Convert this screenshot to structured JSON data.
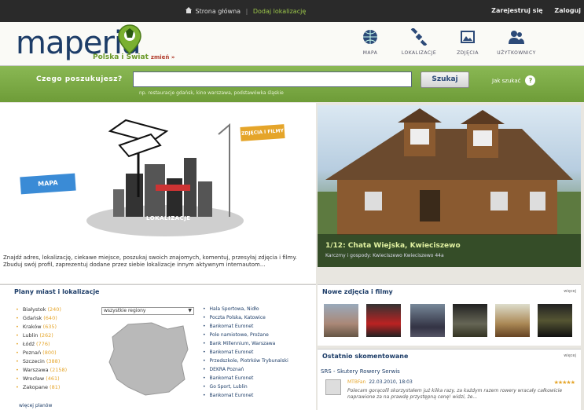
{
  "topbar": {
    "home": "Strona główna",
    "add_location": "Dodaj lokalizację",
    "register": "Zarejestruj się",
    "login": "Zaloguj"
  },
  "header": {
    "logo": "maperia",
    "tagline": "Polska i Świat",
    "change": "zmień »",
    "nav": [
      {
        "label": "MAPA",
        "icon": "globe-icon"
      },
      {
        "label": "LOKALIZACJE",
        "icon": "satellite-icon"
      },
      {
        "label": "ZDJĘCIA",
        "icon": "photo-icon"
      },
      {
        "label": "UŻYTKOWNICY",
        "icon": "users-icon"
      }
    ]
  },
  "search": {
    "question": "Czego poszukujesz?",
    "placeholder": "",
    "hint": "np. restauracje gdańsk, kino warszawa, podstawówka śląskie",
    "button": "Szukaj",
    "how": "Jak szukać"
  },
  "hero": {
    "mapa": "MAPA",
    "zdjecia": "ZDJĘCIA I FILMY",
    "lokalizacje": "LOKALIZACJE",
    "description": "Znajdź adres, lokalizację, ciekawe miejsce, poszukaj swoich znajomych, komentuj, przesyłaj zdjęcia i filmy. Zbuduj swój profil, zaprezentuj dodane przez siebie lokalizacje innym aktywnym internautom..."
  },
  "featured": {
    "title": "1/12: Chata Wiejska, Kwieciszewo",
    "subtitle": "Karczmy i gospody: Kwieciszewo Kwieciszewo 44a"
  },
  "plany": {
    "title": "Plany miast i lokalizacje",
    "cities": [
      {
        "name": "Białystok",
        "count": "(240)"
      },
      {
        "name": "Gdańsk",
        "count": "(640)"
      },
      {
        "name": "Kraków",
        "count": "(635)"
      },
      {
        "name": "Lublin",
        "count": "(262)"
      },
      {
        "name": "Łódź",
        "count": "(776)"
      },
      {
        "name": "Poznań",
        "count": "(800)"
      },
      {
        "name": "Szczecin",
        "count": "(388)"
      },
      {
        "name": "Warszawa",
        "count": "(2158)"
      },
      {
        "name": "Wrocław",
        "count": "(461)"
      },
      {
        "name": "Zakopane",
        "count": "(81)"
      }
    ],
    "more": "więcej planów",
    "region_select": "wszystkie regiony",
    "places": [
      "Hala Sportowa, Nidło",
      "Poczta Polska, Katowice",
      "Bankomat Euronet",
      "Pole namiotowe, Prożane",
      "Bank Millennium, Warszawa",
      "Bankomat Euronet",
      "Przedszkole, Piotrków Trybunalski",
      "DEKRA Poznań",
      "Bankomat Euronet",
      "Go Sport, Lublin",
      "Bankomat Euronet"
    ]
  },
  "nowe": {
    "title": "Nowe zdjęcia i filmy",
    "more": "więcej"
  },
  "ostatnio": {
    "title": "Ostatnio skomentowane",
    "more": "więcej",
    "item_title": "SRS - Skutery Rowery Serwis",
    "user": "MTBFan",
    "date": "22.03.2010, 18:03",
    "stars": "★★★★★",
    "comment": "Polecam gorącolll skorzystałem już kilka razy, za każdym razem rowery wracały całkowicie naprawione za na prawdę przystępną cenę! widzi, że..."
  }
}
